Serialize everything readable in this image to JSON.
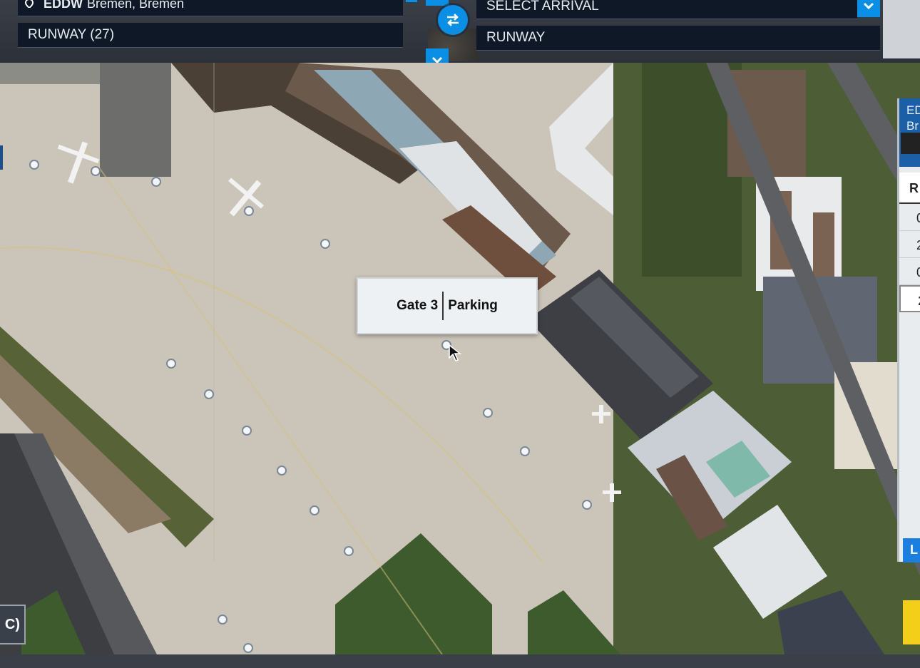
{
  "departure": {
    "airport_code": "EDDW",
    "airport_name": "Bremen, Bremen",
    "clear_label": "x",
    "runway_label": "RUNWAY (27)"
  },
  "arrival": {
    "airport_placeholder": "SELECT ARRIVAL",
    "runway_label": "RUNWAY"
  },
  "tooltip": {
    "gate": "Gate 3",
    "type": "Parking"
  },
  "side_panel": {
    "header_line1": "ED",
    "header_line2": "Br",
    "column_header": "R",
    "rows": [
      "0",
      "2",
      "0",
      "2"
    ],
    "bottom_button": "L"
  },
  "atc_button": "C)",
  "icons": {
    "pin": "location-pin-icon",
    "dropdown": "chevron-down-icon",
    "swap": "swap-arrows-icon",
    "cursor": "mouse-pointer-icon"
  },
  "colors": {
    "accent": "#0a8fe6",
    "bar": "#0f1826",
    "side_header": "#1a5fa8",
    "yellow": "#f3cf1a"
  }
}
